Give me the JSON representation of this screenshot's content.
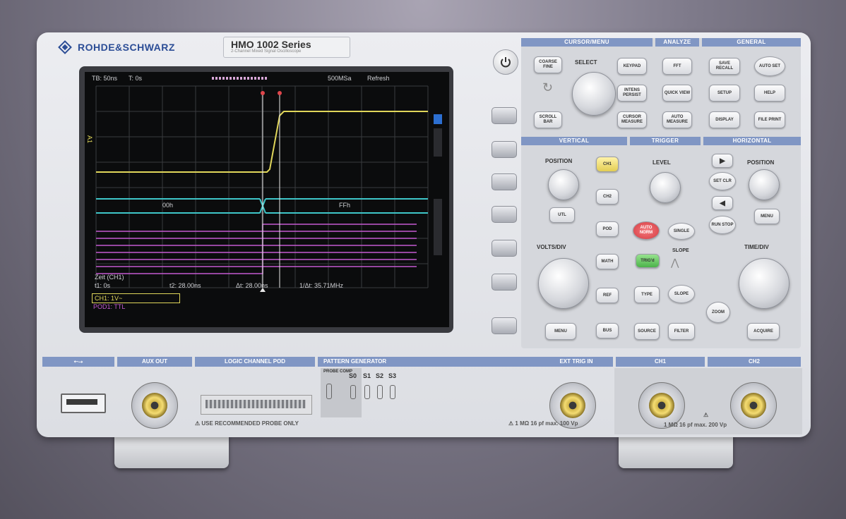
{
  "brand": {
    "name": "ROHDE&SCHWARZ",
    "model": "HMO 1002 Series",
    "model_sub": "2-Channel Mixed Signal Oscilloscope"
  },
  "colors": {
    "ch1": "#e0d65a",
    "ch2": "#3ec6c9",
    "logic": "#c45ad1",
    "accent": "#8096c4",
    "trig_red": "#e0464b",
    "trig_green": "#5bc35a"
  },
  "screen": {
    "top_left": "TB: 50ns",
    "top_t": "T: 0s",
    "sample_rate": "500MSa",
    "mode": "Refresh",
    "bus_left": "00h",
    "bus_right": "FFh",
    "cursor_title": "Zeit (CH1)",
    "cursor_t1": "t1: 0s",
    "cursor_t2": "t2: 28.00ns",
    "cursor_dt": "Δt: 28.00ns",
    "cursor_freq": "1/Δt: 35.71MHz",
    "ch1_info": "CH1: 1V~",
    "pod_info": "POD1: TTL",
    "ch1_marker": "A1"
  },
  "panel": {
    "cursor_menu": "CURSOR/MENU",
    "analyze": "ANALYZE",
    "general": "GENERAL",
    "coarse_fine": "COARSE FINE",
    "select": "SELECT",
    "keypad": "KEYPAD",
    "intens_persist": "INTENS PERSIST",
    "scroll_bar": "SCROLL BAR",
    "cursor_measure": "CURSOR MEASURE",
    "fft": "FFT",
    "quick_view": "QUICK VIEW",
    "auto_measure": "AUTO MEASURE",
    "save_recall": "SAVE RECALL",
    "auto_set": "AUTO SET",
    "setup": "SETUP",
    "help": "HELP",
    "display": "DISPLAY",
    "file_print": "FILE PRINT",
    "vertical": "VERTICAL",
    "trigger": "TRIGGER",
    "horizontal": "HORIZONTAL",
    "position": "POSITION",
    "ch1": "CH1",
    "ch2": "CH2",
    "pod": "POD",
    "math": "MATH",
    "ref": "REF",
    "bus": "BUS",
    "menu": "MENU",
    "utl": "UTL",
    "volts_div": "VOLTS/DIV",
    "level": "LEVEL",
    "auto_norm": "AUTO NORM",
    "single": "SINGLE",
    "slope_label": "SLOPE",
    "trig_d": "TRIG'd",
    "type": "TYPE",
    "slope": "SLOPE",
    "source": "SOURCE",
    "filter": "FILTER",
    "h_position": "POSITION",
    "set_clr": "SET CLR",
    "h_menu": "MENU",
    "run_stop": "RUN STOP",
    "time_div": "TIME/DIV",
    "zoom": "ZOOM",
    "acquire": "ACQUIRE"
  },
  "bottom": {
    "usb": "⭠⭢",
    "aux_out": "AUX OUT",
    "logic_pod": "LOGIC CHANNEL POD",
    "pattern_gen": "PATTERN GENERATOR",
    "probe_comp": "PROBE COMP",
    "s0": "S0",
    "s1": "S1",
    "s2": "S2",
    "s3": "S3",
    "ext_trig": "EXT TRIG IN",
    "ch1": "CH1",
    "ch2": "CH2",
    "probe_warn": "USE RECOMMENDED PROBE ONLY",
    "ext_spec": "1 MΩ  16 pf max. 100 Vp",
    "ch_spec": "1 MΩ  16 pf max. 200 Vp"
  }
}
